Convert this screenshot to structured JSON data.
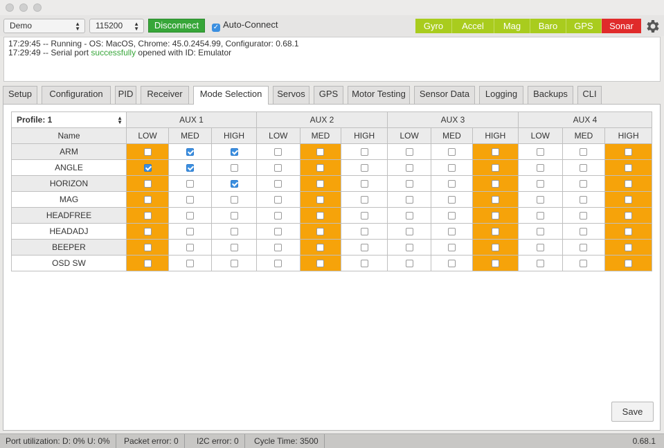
{
  "header": {
    "port": "Demo",
    "baud": "115200",
    "connect_label": "Disconnect",
    "auto_connect_label": "Auto-Connect",
    "sensors": [
      {
        "name": "Gyro",
        "status": "ok",
        "color": "#a9cc1e"
      },
      {
        "name": "Accel",
        "status": "ok",
        "color": "#a9cc1e"
      },
      {
        "name": "Mag",
        "status": "ok",
        "color": "#a9cc1e"
      },
      {
        "name": "Baro",
        "status": "ok",
        "color": "#a9cc1e"
      },
      {
        "name": "GPS",
        "status": "ok",
        "color": "#a9cc1e"
      },
      {
        "name": "Sonar",
        "status": "error",
        "color": "#e02b2b"
      }
    ]
  },
  "log": {
    "line1": "17:29:45 -- Running - OS: MacOS, Chrome: 45.0.2454.99, Configurator: 0.68.1",
    "line2_pre": "17:29:49 -- Serial port ",
    "line2_ok": "successfully",
    "line2_post": " opened with ID: Emulator"
  },
  "tabs": [
    "Setup",
    "Configuration",
    "PID",
    "Receiver",
    "Mode Selection",
    "Servos",
    "GPS",
    "Motor Testing",
    "Sensor Data",
    "Logging",
    "Backups",
    "CLI"
  ],
  "active_tab": "Mode Selection",
  "modes": {
    "profile": "Profile: 1",
    "name_header": "Name",
    "aux": [
      "AUX 1",
      "AUX 2",
      "AUX 3",
      "AUX 4"
    ],
    "levels": [
      "LOW",
      "MED",
      "HIGH"
    ],
    "rows": [
      {
        "name": "ARM",
        "checked": [
          0,
          1,
          1,
          0,
          0,
          0,
          0,
          0,
          0,
          0,
          0,
          0
        ]
      },
      {
        "name": "ANGLE",
        "checked": [
          1,
          1,
          0,
          0,
          0,
          0,
          0,
          0,
          0,
          0,
          0,
          0
        ]
      },
      {
        "name": "HORIZON",
        "checked": [
          0,
          0,
          1,
          0,
          0,
          0,
          0,
          0,
          0,
          0,
          0,
          0
        ]
      },
      {
        "name": "MAG",
        "checked": [
          0,
          0,
          0,
          0,
          0,
          0,
          0,
          0,
          0,
          0,
          0,
          0
        ]
      },
      {
        "name": "HEADFREE",
        "checked": [
          0,
          0,
          0,
          0,
          0,
          0,
          0,
          0,
          0,
          0,
          0,
          0
        ]
      },
      {
        "name": "HEADADJ",
        "checked": [
          0,
          0,
          0,
          0,
          0,
          0,
          0,
          0,
          0,
          0,
          0,
          0
        ]
      },
      {
        "name": "BEEPER",
        "checked": [
          0,
          0,
          0,
          0,
          0,
          0,
          0,
          0,
          0,
          0,
          0,
          0
        ]
      },
      {
        "name": "OSD SW",
        "checked": [
          0,
          0,
          0,
          0,
          0,
          0,
          0,
          0,
          0,
          0,
          0,
          0
        ]
      }
    ],
    "highlight_columns": [
      0,
      4,
      8,
      11
    ],
    "highlight_color": "#f6a30a"
  },
  "save_label": "Save",
  "status": {
    "port_util": "Port utilization: D: 0% U: 0%",
    "packet_error": "Packet error: 0",
    "i2c_error": "I2C error: 0",
    "cycle_time": "Cycle Time: 3500",
    "version": "0.68.1"
  }
}
